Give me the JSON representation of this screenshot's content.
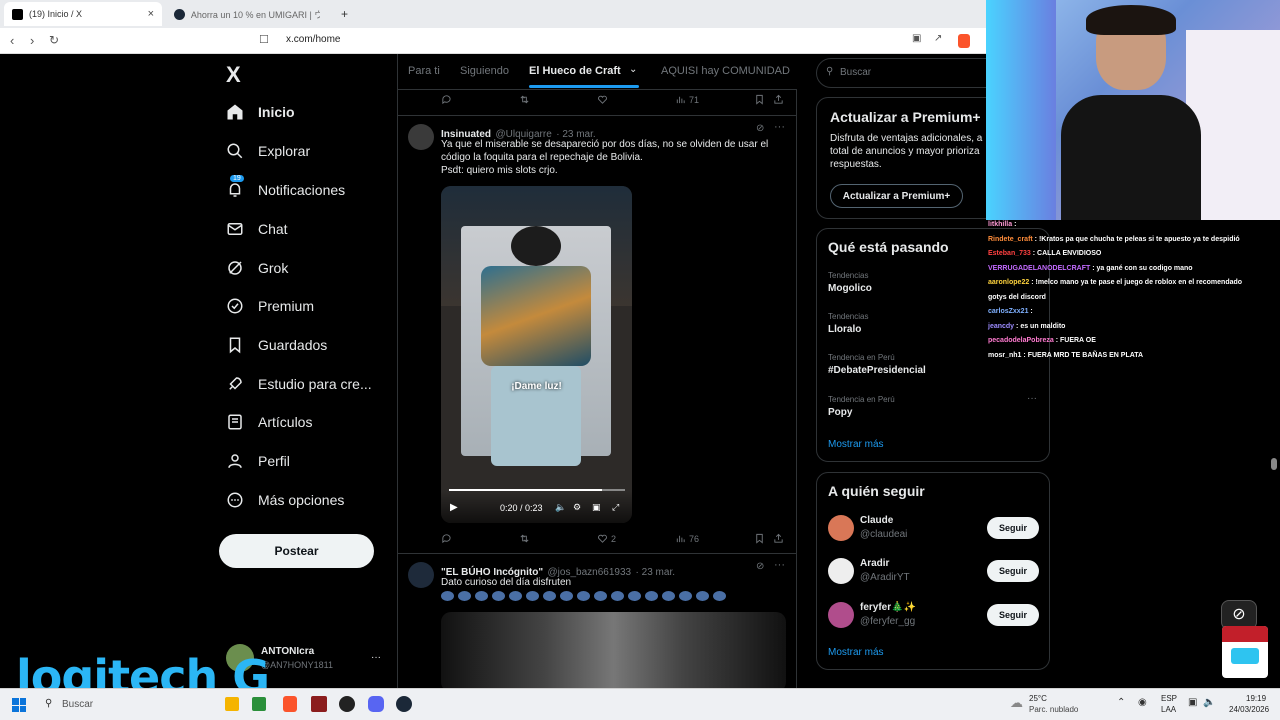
{
  "browser": {
    "tabs": [
      {
        "title": "(19) Inicio / X",
        "active": true
      },
      {
        "title": "Ahorra un 10 % en UMIGARI | ウミガ...",
        "active": false
      }
    ],
    "url": "x.com/home",
    "new_tab": "+",
    "close": "×"
  },
  "sidebar": {
    "logo": "X",
    "items": [
      {
        "label": "Inicio",
        "icon": "home-icon",
        "active": true
      },
      {
        "label": "Explorar",
        "icon": "search-icon"
      },
      {
        "label": "Notificaciones",
        "icon": "bell-icon",
        "badge": "19"
      },
      {
        "label": "Chat",
        "icon": "mail-icon"
      },
      {
        "label": "Grok",
        "icon": "grok-icon"
      },
      {
        "label": "Premium",
        "icon": "verified-icon"
      },
      {
        "label": "Guardados",
        "icon": "bookmark-icon"
      },
      {
        "label": "Estudio para cre...",
        "icon": "rocket-icon"
      },
      {
        "label": "Artículos",
        "icon": "article-icon"
      },
      {
        "label": "Perfil",
        "icon": "user-icon"
      },
      {
        "label": "Más opciones",
        "icon": "more-circle-icon"
      }
    ],
    "post_button": "Postear",
    "account": {
      "name": "ANTONIcra",
      "handle": "@AN7HONY1811",
      "more": "···"
    }
  },
  "center": {
    "tabs": [
      {
        "label": "Para ti",
        "active": false
      },
      {
        "label": "Siguiendo",
        "active": false
      },
      {
        "label": "El Hueco de Craft",
        "active": true
      },
      {
        "label": "AQUISI hay COMUNIDAD",
        "active": false
      }
    ],
    "top_actions": {
      "views": "71"
    },
    "tweets": [
      {
        "name": "Insinuated",
        "handle": "@Ulquigarre",
        "date": "· 23 mar.",
        "text": [
          "Ya que el miserable se desapareció por dos días, no se olviden de usar el",
          "código la foquita para el repechaje de Bolivia.",
          "Psdt: quiero mis slots crjo."
        ],
        "video": {
          "caption": "¡Dame luz!",
          "time": "0:20 / 0:23"
        },
        "likes": "2",
        "views": "76"
      },
      {
        "name": "\"EL BÚHO Incógnito\"",
        "handle": "@jos_bazn661933",
        "date": "· 23 mar.",
        "text": [
          "Dato curioso del día disfruten"
        ]
      }
    ]
  },
  "right": {
    "search_placeholder": "Buscar",
    "premium": {
      "title": "Actualizar a Premium+",
      "body": [
        "Disfruta de ventajas adicionales, a",
        "total de anuncios y mayor prioriza",
        "respuestas."
      ],
      "button": "Actualizar a Premium+"
    },
    "trends": {
      "title": "Qué está pasando",
      "items": [
        {
          "category": "Tendencias",
          "name": "Mogolico"
        },
        {
          "category": "Tendencias",
          "name": "Lloralo"
        },
        {
          "category": "Tendencia en Perú",
          "name": "#DebatePresidencial"
        },
        {
          "category": "Tendencia en Perú",
          "name": "Popy"
        }
      ],
      "more": "Mostrar más"
    },
    "follow": {
      "title": "A quién seguir",
      "items": [
        {
          "name": "Claude",
          "handle": "@claudeai",
          "button": "Seguir"
        },
        {
          "name": "Aradir",
          "handle": "@AradirYT",
          "button": "Seguir"
        },
        {
          "name": "feryfer🎄✨",
          "handle": "@feryfer_gg",
          "button": "Seguir"
        }
      ],
      "more": "Mostrar más"
    }
  },
  "chat": [
    {
      "user": "litkhilla",
      "msg": "",
      "color": "#ff9ad5"
    },
    {
      "user": "Rindete_craft",
      "msg": "!Kratos pa que chucha te peleas si te apuesto ya te despidió",
      "color": "#ff8c3a"
    },
    {
      "user": "Esteban_733",
      "msg": "CALLA ENVIDIOSO",
      "color": "#ff4040"
    },
    {
      "user": "VERRUGADELANODELCRAFT",
      "msg": "ya gané con su codigo mano",
      "color": "#c36bff"
    },
    {
      "user": "aaronlope22",
      "msg": "!melco mano ya te pase el juego de roblox en el recomendado",
      "color": "#ffd33d"
    },
    {
      "user": "",
      "msg": "gotys del discord",
      "color": "#ffffff"
    },
    {
      "user": "carlosZxx21",
      "msg": "",
      "color": "#7fb0ff"
    },
    {
      "user": "jeancdy",
      "msg": "es un maldito",
      "color": "#9c8cff"
    },
    {
      "user": "pecadodelaPobreza",
      "msg": "FUERA OE",
      "color": "#ff7bd0"
    },
    {
      "user": "mosr_nh1",
      "msg": "FUERA MRD TE BAÑAS EN PLATA",
      "color": "#ffffff"
    }
  ],
  "overlay": {
    "brand": "logitech G"
  },
  "taskbar": {
    "search": "Buscar",
    "weather_temp": "25°C",
    "weather_desc": "Parc. nublado",
    "lang1": "ESP",
    "lang2": "LAA",
    "time": "19:19",
    "date": "24/03/2026"
  },
  "colors": {
    "accent": "#1d9bf0",
    "bg": "#000000",
    "border": "#2f3336",
    "muted": "#71767b"
  }
}
